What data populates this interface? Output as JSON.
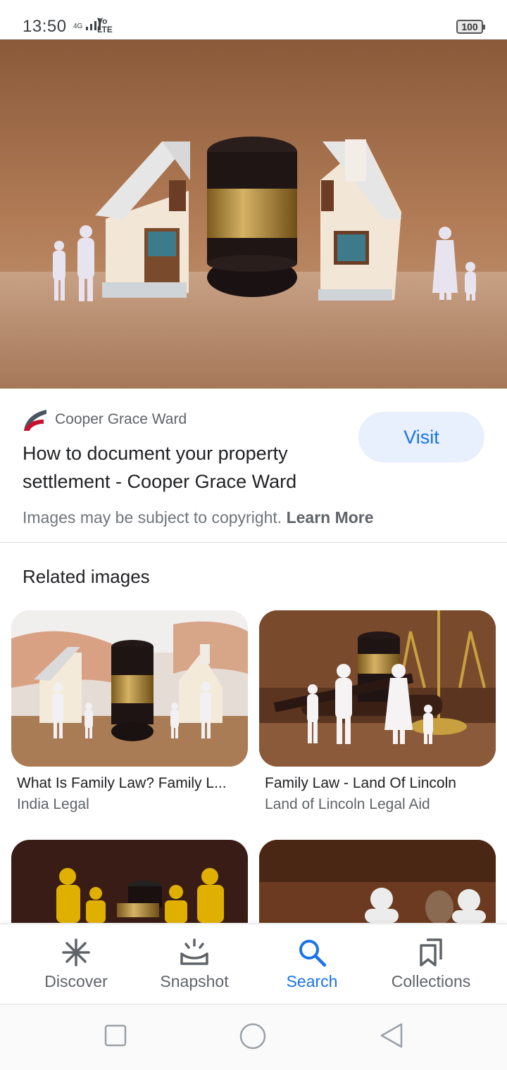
{
  "status_bar": {
    "time": "13:50",
    "network": "4G",
    "volte_top": "Vo",
    "volte_bottom": "LTE",
    "battery": "100"
  },
  "result": {
    "source": "Cooper Grace Ward",
    "title": "How to document your property settlement - Cooper Grace Ward",
    "visit_label": "Visit",
    "copyright_text": "Images may be subject to copyright.",
    "learn_more": "Learn More"
  },
  "related": {
    "heading": "Related images",
    "items": [
      {
        "title": "What Is Family Law? Family L...",
        "source": "India Legal"
      },
      {
        "title": "Family Law - Land Of Lincoln",
        "source": "Land of Lincoln Legal Aid"
      }
    ]
  },
  "bottom_nav": {
    "items": [
      {
        "label": "Discover",
        "icon": "asterisk-icon"
      },
      {
        "label": "Snapshot",
        "icon": "snapshot-icon"
      },
      {
        "label": "Search",
        "icon": "search-icon"
      },
      {
        "label": "Collections",
        "icon": "bookmarks-icon"
      }
    ],
    "active": "Search"
  },
  "colors": {
    "accent": "#1a73e8",
    "visit_bg": "#e8f0fe"
  }
}
